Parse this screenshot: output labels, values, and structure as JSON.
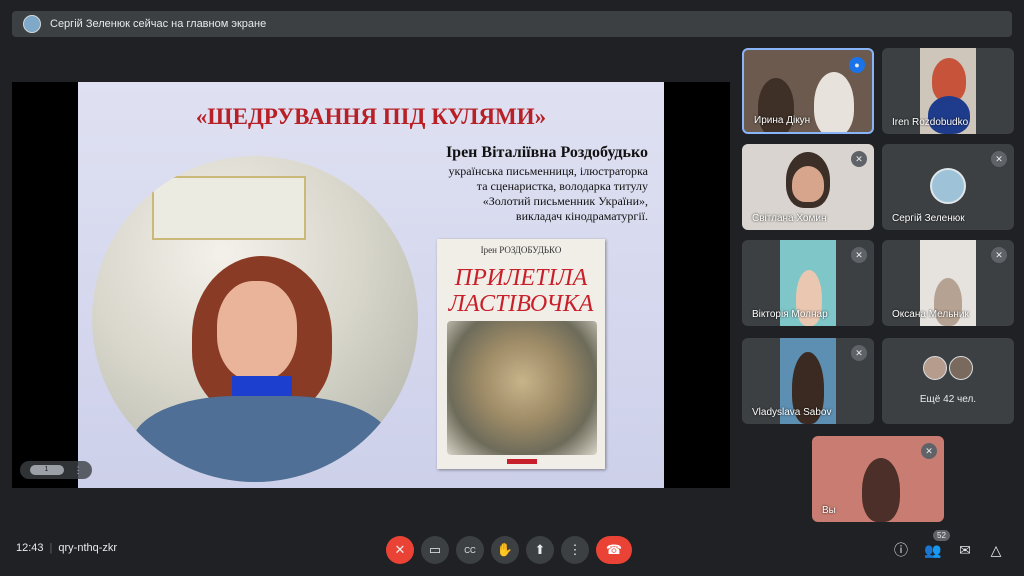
{
  "banner": {
    "text": "Сергій Зеленюк сейчас на главном экране"
  },
  "slide": {
    "title": "«ЩЕДРУВАННЯ ПІД  КУЛЯМИ»",
    "author_name": "Ірен Віталіївна Роздобудько",
    "author_desc": [
      "українська письменниця, ілюстраторка",
      "та сценаристка, володарка титулу",
      "«Золотий письменник України»,",
      "викладач кінодраматургії."
    ],
    "book": {
      "author": "Ірен РОЗДОБУДЬКО",
      "title_line1": "ПРИЛЕТІЛА",
      "title_line2": "ЛАСТІВОЧКА"
    },
    "page_indicator": "1"
  },
  "participants": [
    {
      "name": "Ирина Дікун",
      "status": "speaking-icon"
    },
    {
      "name": "Iren Rozdobudko",
      "status": "none"
    },
    {
      "name": "Світлана Хомин",
      "status": "mic-off-icon"
    },
    {
      "name": "Сергій Зеленюк",
      "status": "mic-off-icon"
    },
    {
      "name": "Вікторія Молнар",
      "status": "mic-off-icon"
    },
    {
      "name": "Оксана Мельник",
      "status": "mic-off-icon"
    },
    {
      "name": "Vladyslava Sabov",
      "status": "mic-off-icon"
    }
  ],
  "more": {
    "label": "Ещё 42 чел."
  },
  "self": {
    "name": "Вы"
  },
  "bottom": {
    "time": "12:43",
    "meeting_code": "qry-nthq-zkr",
    "people_count": "52"
  }
}
